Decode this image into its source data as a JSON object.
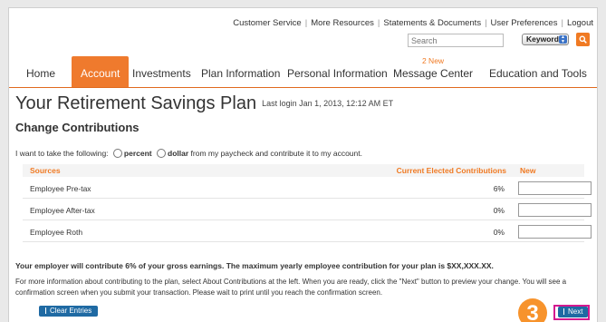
{
  "utility_links": [
    "Customer Service",
    "More Resources",
    "Statements & Documents",
    "User Preferences",
    "Logout"
  ],
  "search": {
    "placeholder": "Search",
    "type_selected": "Keyword"
  },
  "nav": {
    "items": [
      "Home",
      "Account",
      "Investments",
      "Plan Information",
      "Personal Information",
      "Message Center",
      "Education and Tools"
    ],
    "active": "Account",
    "message_badge": "2 New"
  },
  "page": {
    "title": "Your Retirement Savings Plan",
    "last_login": "Last login Jan 1, 2013, 12:12 AM ET"
  },
  "section_title": "Change Contributions",
  "intent": {
    "prefix": "I want to take the following:",
    "option_percent": "percent",
    "option_dollar": "dollar",
    "suffix": "from my paycheck and contribute it to my account."
  },
  "table": {
    "headers": {
      "sources": "Sources",
      "current": "Current Elected Contributions",
      "new": "New"
    },
    "rows": [
      {
        "source": "Employee Pre-tax",
        "current": "6%"
      },
      {
        "source": "Employee After-tax",
        "current": "0%"
      },
      {
        "source": "Employee Roth",
        "current": "0%"
      }
    ]
  },
  "employer_note": "Your employer will contribute 6% of your gross earnings. The maximum yearly employee contribution for your plan is $XX,XXX.XX.",
  "info_text": "For more information about contributing to the plan, select About Contributions at the left. When you are ready, click the \"Next\" button to preview your change. You will see a confirmation screen when you submit your transaction. Please wait to print until you reach the confirmation screen.",
  "buttons": {
    "clear": "Clear Entries",
    "next": "Next"
  },
  "step_marker": "3",
  "colors": {
    "accent": "#ef7a2d",
    "button_blue": "#1f6aa3",
    "highlight": "#d4198f"
  }
}
